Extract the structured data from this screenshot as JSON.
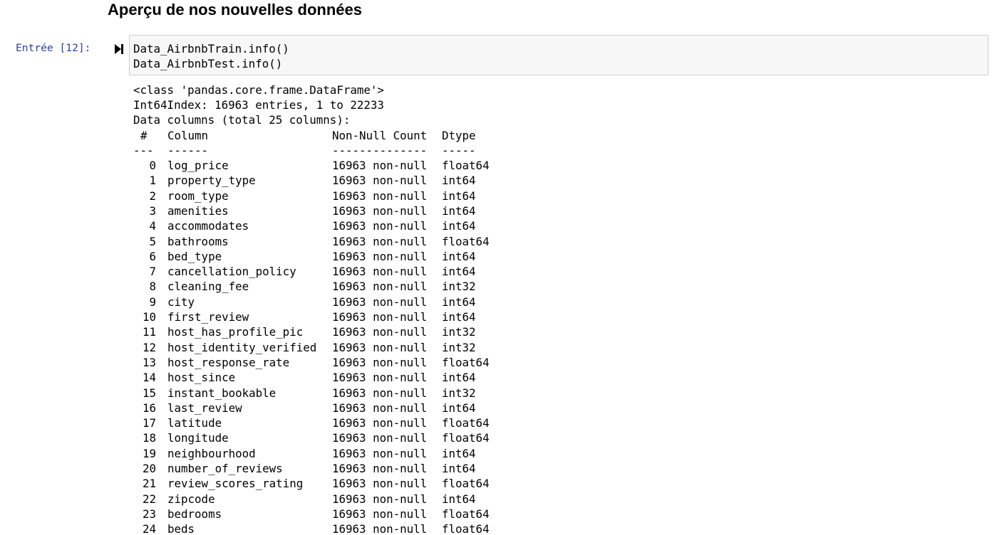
{
  "heading": "Aperçu de nos nouvelles données",
  "cell": {
    "prompt": "Entrée [12]:",
    "code_lines": [
      "Data_AirbnbTrain.info()",
      "Data_AirbnbTest.info()"
    ]
  },
  "output": {
    "preamble": [
      "<class 'pandas.core.frame.DataFrame'>",
      "Int64Index: 16963 entries, 1 to 22233",
      "Data columns (total 25 columns):"
    ],
    "header": {
      "idx": "#",
      "column": "Column",
      "count": "Non-Null Count",
      "dtype": "Dtype"
    },
    "separator": {
      "idx": "---",
      "column": "------",
      "count": "--------------",
      "dtype": "-----"
    },
    "rows": [
      {
        "idx": "0",
        "column": "log_price",
        "count": "16963 non-null",
        "dtype": "float64"
      },
      {
        "idx": "1",
        "column": "property_type",
        "count": "16963 non-null",
        "dtype": "int64"
      },
      {
        "idx": "2",
        "column": "room_type",
        "count": "16963 non-null",
        "dtype": "int64"
      },
      {
        "idx": "3",
        "column": "amenities",
        "count": "16963 non-null",
        "dtype": "int64"
      },
      {
        "idx": "4",
        "column": "accommodates",
        "count": "16963 non-null",
        "dtype": "int64"
      },
      {
        "idx": "5",
        "column": "bathrooms",
        "count": "16963 non-null",
        "dtype": "float64"
      },
      {
        "idx": "6",
        "column": "bed_type",
        "count": "16963 non-null",
        "dtype": "int64"
      },
      {
        "idx": "7",
        "column": "cancellation_policy",
        "count": "16963 non-null",
        "dtype": "int64"
      },
      {
        "idx": "8",
        "column": "cleaning_fee",
        "count": "16963 non-null",
        "dtype": "int32"
      },
      {
        "idx": "9",
        "column": "city",
        "count": "16963 non-null",
        "dtype": "int64"
      },
      {
        "idx": "10",
        "column": "first_review",
        "count": "16963 non-null",
        "dtype": "int64"
      },
      {
        "idx": "11",
        "column": "host_has_profile_pic",
        "count": "16963 non-null",
        "dtype": "int32"
      },
      {
        "idx": "12",
        "column": "host_identity_verified",
        "count": "16963 non-null",
        "dtype": "int32"
      },
      {
        "idx": "13",
        "column": "host_response_rate",
        "count": "16963 non-null",
        "dtype": "float64"
      },
      {
        "idx": "14",
        "column": "host_since",
        "count": "16963 non-null",
        "dtype": "int64"
      },
      {
        "idx": "15",
        "column": "instant_bookable",
        "count": "16963 non-null",
        "dtype": "int32"
      },
      {
        "idx": "16",
        "column": "last_review",
        "count": "16963 non-null",
        "dtype": "int64"
      },
      {
        "idx": "17",
        "column": "latitude",
        "count": "16963 non-null",
        "dtype": "float64"
      },
      {
        "idx": "18",
        "column": "longitude",
        "count": "16963 non-null",
        "dtype": "float64"
      },
      {
        "idx": "19",
        "column": "neighbourhood",
        "count": "16963 non-null",
        "dtype": "int64"
      },
      {
        "idx": "20",
        "column": "number_of_reviews",
        "count": "16963 non-null",
        "dtype": "int64"
      },
      {
        "idx": "21",
        "column": "review_scores_rating",
        "count": "16963 non-null",
        "dtype": "float64"
      },
      {
        "idx": "22",
        "column": "zipcode",
        "count": "16963 non-null",
        "dtype": "int64"
      },
      {
        "idx": "23",
        "column": "bedrooms",
        "count": "16963 non-null",
        "dtype": "float64"
      },
      {
        "idx": "24",
        "column": "beds",
        "count": "16963 non-null",
        "dtype": "float64"
      }
    ]
  },
  "colors": {
    "prompt": "#303f9f",
    "input_bg": "#f7f7f7",
    "input_border": "#cfcfcf"
  },
  "icons": {
    "run": "run-cell-icon"
  }
}
